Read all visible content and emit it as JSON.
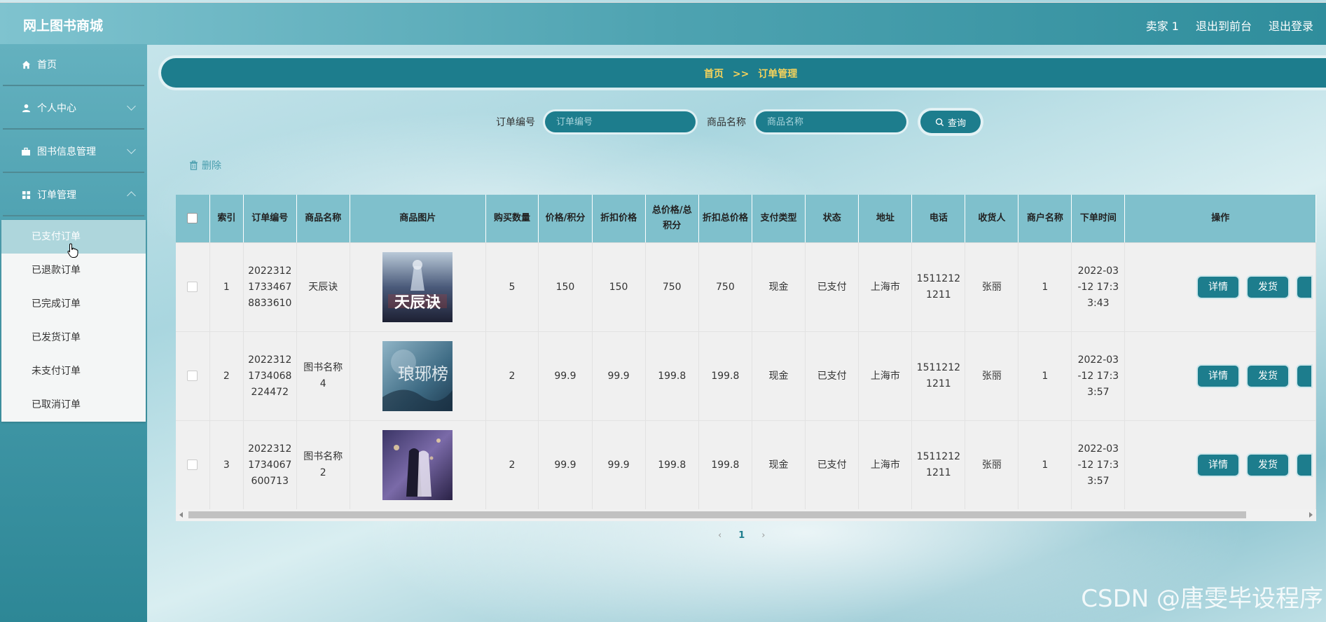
{
  "header": {
    "brand": "网上图书商城",
    "user": "卖家 1",
    "back_front": "退出到前台",
    "logout": "退出登录"
  },
  "sidebar": {
    "items": [
      {
        "label": "首页",
        "icon": "home-icon"
      },
      {
        "label": "个人中心",
        "icon": "user-icon"
      },
      {
        "label": "图书信息管理",
        "icon": "briefcase-icon"
      },
      {
        "label": "订单管理",
        "icon": "grid-icon"
      }
    ],
    "submenu": [
      "已支付订单",
      "已退款订单",
      "已完成订单",
      "已发货订单",
      "未支付订单",
      "已取消订单"
    ]
  },
  "breadcrumb": {
    "home": "首页",
    "sep": ">>",
    "current": "订单管理"
  },
  "search": {
    "order_no_label": "订单编号",
    "order_no_placeholder": "订单编号",
    "product_label": "商品名称",
    "product_placeholder": "商品名称",
    "query_label": "查询"
  },
  "toolbar": {
    "delete_label": "删除"
  },
  "table": {
    "headers": [
      "索引",
      "订单编号",
      "商品名称",
      "商品图片",
      "购买数量",
      "价格/积分",
      "折扣价格",
      "总价格/总积分",
      "折扣总价格",
      "支付类型",
      "状态",
      "地址",
      "电话",
      "收货人",
      "商户名称",
      "下单时间",
      "操作"
    ],
    "rows": [
      {
        "index": "1",
        "order_no": "20223121733467 8833610",
        "name": "天辰诀",
        "qty": "5",
        "price": "150",
        "discount_price": "150",
        "total": "750",
        "discount_total": "750",
        "pay_type": "现金",
        "status": "已支付",
        "address": "上海市",
        "phone": "15112121211",
        "receiver": "张丽",
        "merchant": "1",
        "time": "2022-03-12 17:33:43",
        "cover_title": "天辰诀"
      },
      {
        "index": "2",
        "order_no": "20223121734068 224472",
        "name": "图书名称4",
        "qty": "2",
        "price": "99.9",
        "discount_price": "99.9",
        "total": "199.8",
        "discount_total": "199.8",
        "pay_type": "现金",
        "status": "已支付",
        "address": "上海市",
        "phone": "15112121211",
        "receiver": "张丽",
        "merchant": "1",
        "time": "2022-03-12 17:33:57",
        "cover_title": "琅琊榜"
      },
      {
        "index": "3",
        "order_no": "20223121734067 600713",
        "name": "图书名称2",
        "qty": "2",
        "price": "99.9",
        "discount_price": "99.9",
        "total": "199.8",
        "discount_total": "199.8",
        "pay_type": "现金",
        "status": "已支付",
        "address": "上海市",
        "phone": "15112121211",
        "receiver": "张丽",
        "merchant": "1",
        "time": "2022-03-12 17:33:57",
        "cover_title": ""
      }
    ],
    "ops": {
      "detail": "详情",
      "ship": "发货"
    }
  },
  "pager": {
    "current": "1"
  },
  "watermark": "CSDN @唐雯毕设程序",
  "colors": {
    "primary": "#1d7d8d",
    "crumb": "#f6d35b",
    "header_bg": "#7fc0cc"
  }
}
